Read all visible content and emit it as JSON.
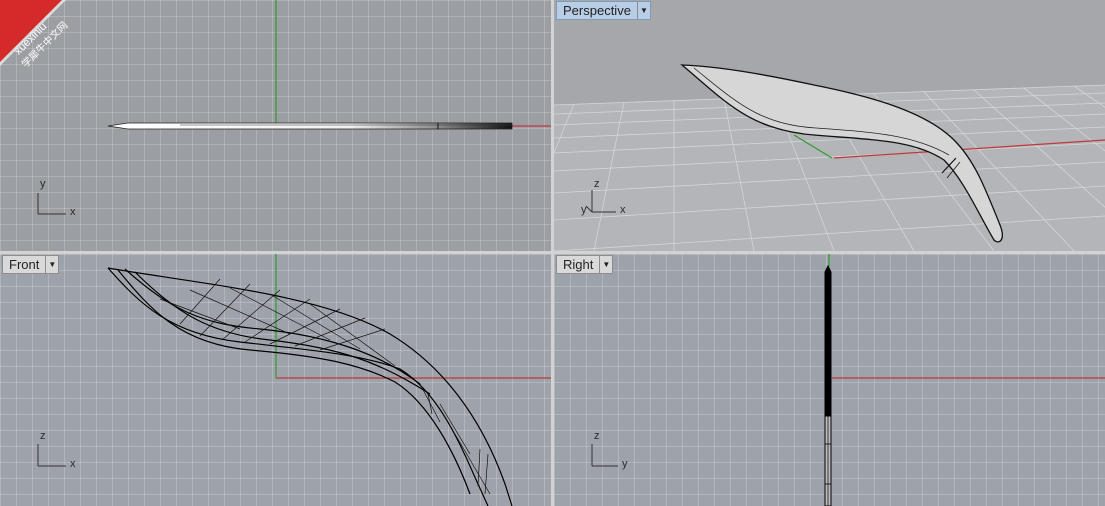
{
  "viewports": {
    "top": {
      "axis_labels": {
        "a": "y",
        "b": "x"
      }
    },
    "perspective": {
      "label": "Perspective",
      "axis_labels": {
        "a": "z",
        "b": "x",
        "c": "y"
      }
    },
    "front": {
      "label": "Front",
      "axis_labels": {
        "a": "z",
        "b": "x"
      }
    },
    "right": {
      "label": "Right",
      "axis_labels": {
        "a": "z",
        "b": "y"
      }
    }
  },
  "watermark": {
    "line1": "xuexiniu",
    "line2": "学犀牛中文网"
  },
  "colors": {
    "x_axis": "#c0393b",
    "y_axis": "#2e9a2e",
    "active_tab": "#b8cde6",
    "watermark_bg": "#d42a2a"
  },
  "icons": {
    "tab_menu": "triangle-down",
    "axis_widget": "axis-icon"
  }
}
